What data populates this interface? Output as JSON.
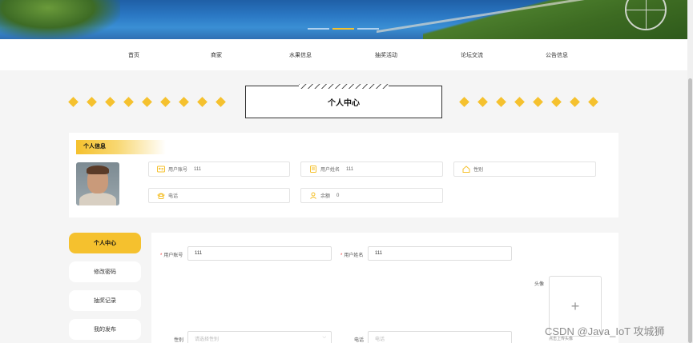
{
  "banner": {
    "slides": 3,
    "active_slide": 2
  },
  "nav": {
    "items": [
      "首页",
      "商家",
      "水果信息",
      "抽奖活动",
      "论坛交流",
      "公告信息"
    ]
  },
  "page_title": "个人中心",
  "info": {
    "tag": "个人信息",
    "username_label": "用户账号",
    "username_value": "111",
    "realname_label": "用户姓名",
    "realname_value": "111",
    "gender_label": "性别",
    "phone_label": "电话",
    "balance_label": "余额",
    "balance_value": "0"
  },
  "sidebar": {
    "items": [
      "个人中心",
      "修改密码",
      "抽奖记录",
      "我的发布"
    ]
  },
  "form": {
    "username_label": "用户账号",
    "username_value": "111",
    "realname_label": "用户姓名",
    "realname_value": "111",
    "avatar_label": "头像",
    "upload_plus": "+",
    "upload_tip": "点击上传头像",
    "gender_label": "性别",
    "gender_placeholder": "请选择性别",
    "phone_label": "电话",
    "phone_placeholder": "电话"
  },
  "watermark": "CSDN @Java_IoT 攻城狮",
  "colors": {
    "accent": "#f5c12e",
    "required": "#ee3333"
  }
}
